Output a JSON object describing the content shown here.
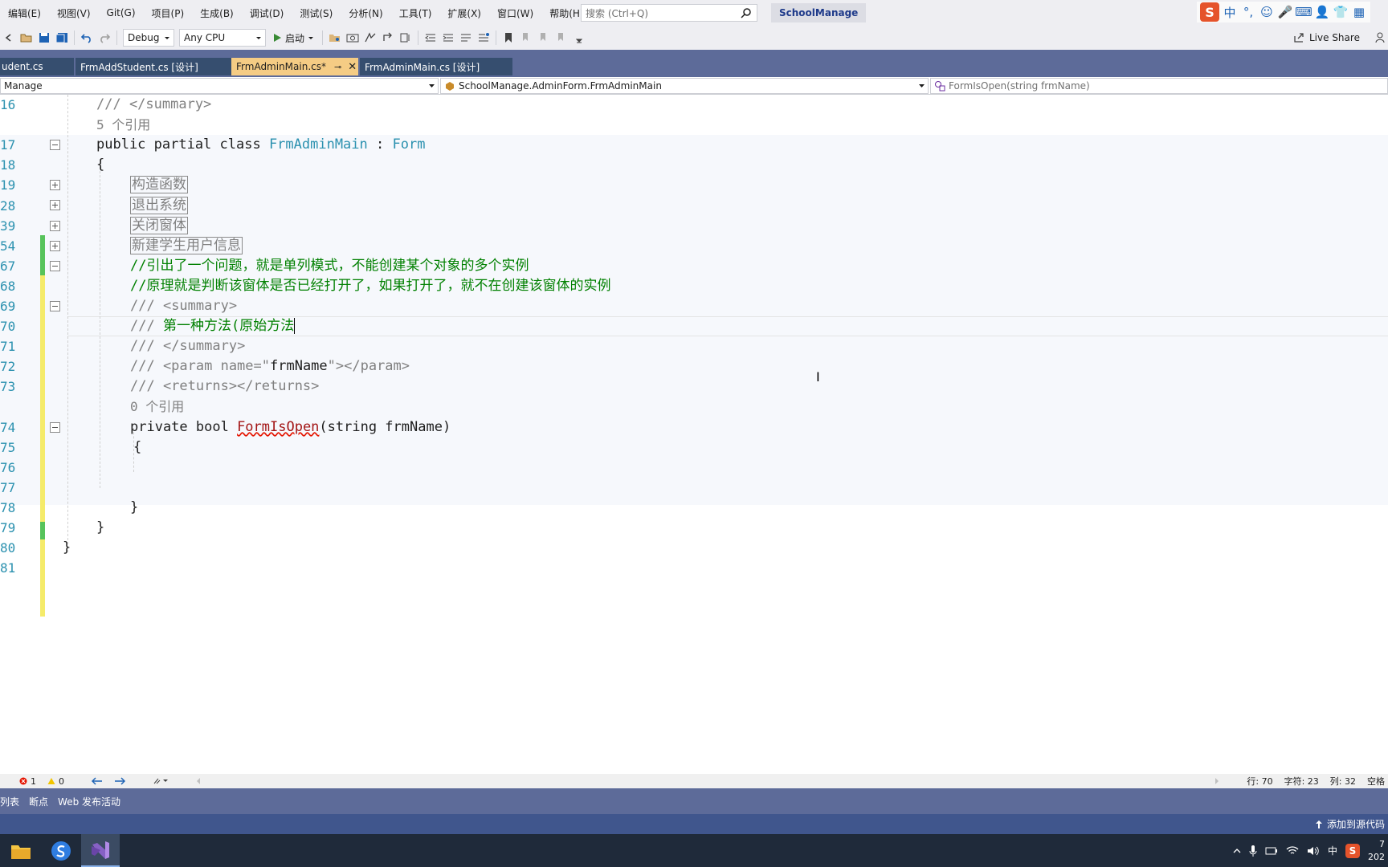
{
  "menu": [
    "编辑(E)",
    "视图(V)",
    "Git(G)",
    "项目(P)",
    "生成(B)",
    "调试(D)",
    "测试(S)",
    "分析(N)",
    "工具(T)",
    "扩展(X)",
    "窗口(W)",
    "帮助(H)"
  ],
  "search": {
    "placeholder": "搜索 (Ctrl+Q)"
  },
  "solution_name": "SchoolManage",
  "ime": {
    "logo": "S",
    "items": [
      "中",
      "°,",
      "☺",
      "🎤",
      "⌨",
      "👤",
      "👕",
      "▦"
    ]
  },
  "toolbar": {
    "config": "Debug",
    "platform": "Any CPU",
    "start_label": "启动",
    "live_share": "Live Share"
  },
  "tabs": [
    {
      "label": "udent.cs",
      "active": false
    },
    {
      "label": "FrmAddStudent.cs [设计]",
      "active": false
    },
    {
      "label": "FrmAdminMain.cs*",
      "active": true
    },
    {
      "label": "FrmAdminMain.cs [设计]",
      "active": false
    }
  ],
  "navbar": {
    "project": "Manage",
    "class": "SchoolManage.AdminForm.FrmAdminMain",
    "member": "FormIsOpen(string frmName)"
  },
  "code": {
    "line_numbers": [
      "16",
      "",
      "17",
      "18",
      "19",
      "28",
      "39",
      "54",
      "67",
      "68",
      "69",
      "70",
      "71",
      "72",
      "73",
      "",
      "74",
      "75",
      "76",
      "77",
      "78",
      "79",
      "80",
      "81"
    ],
    "l16": "/// </summary>",
    "refs5": "5 个引用",
    "l17_kw": "public partial class ",
    "l17_name": "FrmAdminMain",
    "l17_colon": " : ",
    "l17_base": "Form",
    "brace_open": "{",
    "brace_close": "}",
    "region_ctor": "构造函数",
    "region_exit": "退出系统",
    "region_close": "关闭窗体",
    "region_new": "新建学生用户信息",
    "c67": "//引出了一个问题，就是单列模式，不能创建某个对象的多个实例",
    "c68": "//原理就是判断该窗体是否已经打开了，如果打开了，就不在创建该窗体的实例",
    "d69_slash": "/// ",
    "d69_tag": "<summary>",
    "d70_slash": "/// ",
    "d70_text": "第一种方法(原始方法",
    "d71_slash": "/// ",
    "d71_tag": "</summary>",
    "d72_a": "/// <param name=\"",
    "d72_b": "frmName",
    "d72_c": "\"></param>",
    "d73": "/// <returns></returns>",
    "refs0": "0 个引用",
    "l74_kw": "private bool ",
    "l74_method": "FormIsOpen",
    "l74_args": "(string frmName)"
  },
  "edstatus": {
    "errors": "1",
    "warnings": "0",
    "line": "行: 70",
    "char": "字符: 23",
    "col": "列: 32",
    "space": "空格"
  },
  "tooltabs": [
    "列表",
    "断点",
    "Web 发布活动"
  ],
  "statusbar": {
    "source_control": "添加到源代码"
  },
  "tray": {
    "ime": "中",
    "time": "7",
    "date": "202"
  }
}
